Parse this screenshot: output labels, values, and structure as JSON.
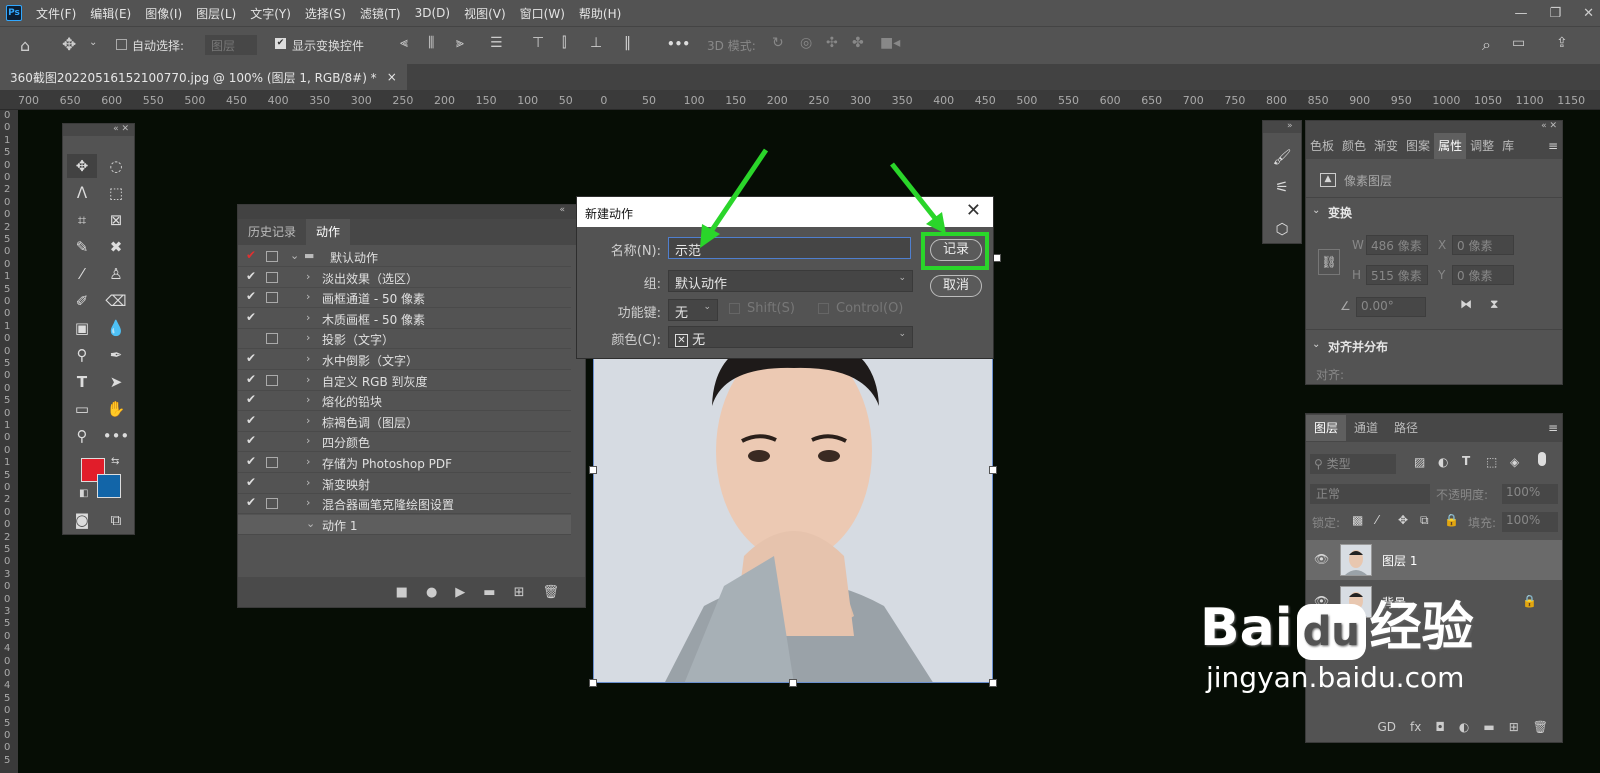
{
  "app": {
    "logo": "Ps"
  },
  "menu": [
    "文件(F)",
    "编辑(E)",
    "图像(I)",
    "图层(L)",
    "文字(Y)",
    "选择(S)",
    "滤镜(T)",
    "3D(D)",
    "视图(V)",
    "窗口(W)",
    "帮助(H)"
  ],
  "options": {
    "auto_select": "自动选择:",
    "layer_select": "图层",
    "show_transform": "显示变换控件",
    "mode_3d": "3D 模式:",
    "more": "•••"
  },
  "document": {
    "tab_title": "360截图20220516152100770.jpg @ 100% (图层 1, RGB/8#) *",
    "close": "×"
  },
  "ruler": [
    "700",
    "650",
    "600",
    "550",
    "500",
    "450",
    "400",
    "350",
    "300",
    "250",
    "200",
    "150",
    "100",
    "50",
    "0",
    "50",
    "100",
    "150",
    "200",
    "250",
    "300",
    "350",
    "400",
    "450",
    "500",
    "550",
    "600",
    "650",
    "700",
    "750",
    "800",
    "850",
    "900",
    "950",
    "1000",
    "1050",
    "1100",
    "1150"
  ],
  "actions_panel": {
    "tab_history": "历史记录",
    "tab_actions": "动作",
    "rows": [
      {
        "label": "默认动作",
        "check": "✔",
        "dlg": true,
        "folder": true,
        "expanded": true,
        "red": true
      },
      {
        "label": "淡出效果（选区）",
        "check": "✔",
        "dlg": true
      },
      {
        "label": "画框通道 - 50 像素",
        "check": "✔",
        "dlg": true
      },
      {
        "label": "木质画框 - 50 像素",
        "check": "✔",
        "dlg": false
      },
      {
        "label": "投影（文字）",
        "check": "",
        "dlg": true
      },
      {
        "label": "水中倒影（文字）",
        "check": "✔",
        "dlg": false
      },
      {
        "label": "自定义 RGB 到灰度",
        "check": "✔",
        "dlg": true
      },
      {
        "label": "熔化的铅块",
        "check": "✔",
        "dlg": false
      },
      {
        "label": "棕褐色调（图层）",
        "check": "✔",
        "dlg": false
      },
      {
        "label": "四分颜色",
        "check": "✔",
        "dlg": false
      },
      {
        "label": "存储为 Photoshop PDF",
        "check": "✔",
        "dlg": true
      },
      {
        "label": "渐变映射",
        "check": "✔",
        "dlg": false
      },
      {
        "label": "混合器画笔克隆绘图设置",
        "check": "✔",
        "dlg": true
      },
      {
        "label": "动作 1",
        "check": "",
        "dlg": false,
        "sub": true
      }
    ],
    "footer": [
      "■",
      "●",
      "▶",
      "▬",
      "⊞",
      "🗑"
    ]
  },
  "dialog": {
    "title": "新建动作",
    "close": "✕",
    "name_label": "名称(N):",
    "name_value": "示范",
    "group_label": "组:",
    "group_value": "默认动作",
    "fkey_label": "功能键:",
    "fkey_value": "无",
    "shift": "Shift(S)",
    "control": "Control(O)",
    "color_label": "颜色(C):",
    "color_value": "无",
    "record": "记录",
    "cancel": "取消"
  },
  "properties": {
    "tabs": [
      "色板",
      "颜色",
      "渐变",
      "图案",
      "属性",
      "调整",
      "库"
    ],
    "active_tab": "属性",
    "type": "像素图层",
    "transform": "变换",
    "w_label": "W",
    "w_val": "486 像素",
    "h_label": "H",
    "h_val": "515 像素",
    "x_label": "X",
    "x_val": "0 像素",
    "y_label": "Y",
    "y_val": "0 像素",
    "angle": "0.00°",
    "align": "对齐并分布",
    "align_sub": "对齐:"
  },
  "layers": {
    "tabs": [
      "图层",
      "通道",
      "路径"
    ],
    "filter": "类型",
    "blend": "正常",
    "opacity_label": "不透明度:",
    "opacity": "100%",
    "lock_label": "锁定:",
    "fill_label": "填充:",
    "fill": "100%",
    "items": [
      {
        "name": "图层 1",
        "selected": true
      },
      {
        "name": "背景",
        "locked": true
      }
    ],
    "footer": [
      "GD",
      "fx",
      "◘",
      "◐",
      "▬",
      "⊞",
      "🗑"
    ]
  },
  "watermark": {
    "brand": "Bai",
    "paw": "du",
    "suffix": "经验",
    "url": "jingyan.baidu.com"
  }
}
